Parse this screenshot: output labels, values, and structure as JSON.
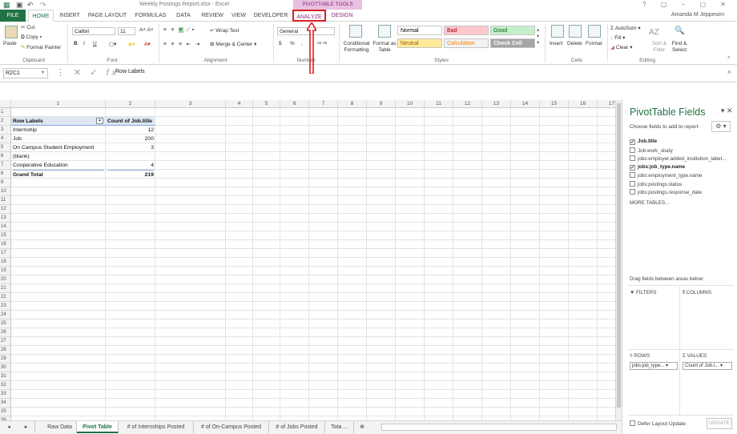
{
  "window": {
    "title": "Weekly Postings Report.xlsx - Excel",
    "context_tab_group": "PIVOTTABLE TOOLS",
    "user": "Amanda M Jeppesen"
  },
  "ribbon_tabs": [
    "FILE",
    "HOME",
    "INSERT",
    "PAGE LAYOUT",
    "FORMULAS",
    "DATA",
    "REVIEW",
    "VIEW",
    "DEVELOPER",
    "ANALYZE",
    "DESIGN"
  ],
  "clipboard": {
    "cut": "Cut",
    "copy": "Copy",
    "paste": "Paste",
    "format_painter": "Format Painter",
    "label": "Clipboard"
  },
  "font": {
    "name": "Calibri",
    "size": "11",
    "bold": "B",
    "italic": "I",
    "underline": "U",
    "label": "Font"
  },
  "alignment": {
    "wrap": "Wrap Text",
    "merge": "Merge & Center",
    "label": "Alignment"
  },
  "number": {
    "format": "General",
    "currency": "$",
    "percent": "%",
    "comma": ",",
    "label": "Number"
  },
  "styles": {
    "conditional": "Conditional Formatting",
    "format_table": "Format as Table",
    "cells": [
      {
        "label": "Normal",
        "bg": "#ffffff",
        "fg": "#000000"
      },
      {
        "label": "Bad",
        "bg": "#ffc7ce",
        "fg": "#9c0006"
      },
      {
        "label": "Good",
        "bg": "#c6efce",
        "fg": "#006100"
      },
      {
        "label": "Neutral",
        "bg": "#ffeb9c",
        "fg": "#9c5700"
      },
      {
        "label": "Calculation",
        "bg": "#f2f2f2",
        "fg": "#fa7d00"
      },
      {
        "label": "Check Cell",
        "bg": "#a5a5a5",
        "fg": "#ffffff"
      }
    ],
    "label": "Styles"
  },
  "cells_group": {
    "insert": "Insert",
    "delete": "Delete",
    "format": "Format",
    "label": "Cells"
  },
  "editing": {
    "autosum": "AutoSum",
    "fill": "Fill",
    "clear": "Clear",
    "sort": "Sort & Filter",
    "find": "Find & Select",
    "label": "Editing"
  },
  "formula_bar": {
    "name_box": "R2C1",
    "fx": "fx",
    "content": "Row Labels"
  },
  "columns": [
    "1",
    "2",
    "3",
    "4",
    "5",
    "6",
    "7",
    "8",
    "9",
    "10",
    "11",
    "12",
    "13",
    "14",
    "15",
    "16",
    "17"
  ],
  "rows": [
    "1",
    "2",
    "3",
    "4",
    "5",
    "6",
    "7",
    "8",
    "9",
    "10",
    "11",
    "12",
    "13",
    "14",
    "15",
    "16",
    "17",
    "18",
    "19",
    "20",
    "21",
    "22",
    "23",
    "24",
    "25",
    "26",
    "27",
    "28",
    "29",
    "30",
    "31",
    "32",
    "33",
    "34",
    "35",
    "36"
  ],
  "pivot": {
    "header_label": "Row Labels",
    "header_value": "Count of Job.title",
    "rows": [
      {
        "label": "Internship",
        "value": "12"
      },
      {
        "label": "Job",
        "value": "200"
      },
      {
        "label": "On Campus Student Employment",
        "value": "3"
      },
      {
        "label": "(blank)",
        "value": ""
      },
      {
        "label": "Cooperative Education",
        "value": "4"
      }
    ],
    "total_label": "Grand Total",
    "total_value": "219"
  },
  "sheet_tabs": [
    "Raw Data",
    "Pivot Table",
    "# of Internships Posted",
    "# of On-Campus Posted",
    "# of Jobs Posted",
    "Tota ..."
  ],
  "active_sheet": "Pivot Table",
  "panel": {
    "title": "PivotTable Fields",
    "subtitle": "Choose fields to add to report:",
    "fields": [
      {
        "label": "Job.title",
        "checked": true
      },
      {
        "label": "Job.work_study",
        "checked": false
      },
      {
        "label": "jobs:employer.added_institution_label...",
        "checked": false
      },
      {
        "label": "jobs:job_type.name",
        "checked": true
      },
      {
        "label": "jobs:employment_type.name",
        "checked": false
      },
      {
        "label": "jobs:postings.status",
        "checked": false
      },
      {
        "label": "jobs:postings.response_date",
        "checked": false
      }
    ],
    "more_tables": "MORE TABLES...",
    "drag_hint": "Drag fields between areas below:",
    "filters": "FILTERS",
    "columns": "COLUMNS",
    "rows": "ROWS",
    "values": "VALUES",
    "rows_pill": "jobs:job_type...",
    "values_pill": "Count of Job.t...",
    "defer": "Defer Layout Update",
    "update": "UPDATE"
  }
}
